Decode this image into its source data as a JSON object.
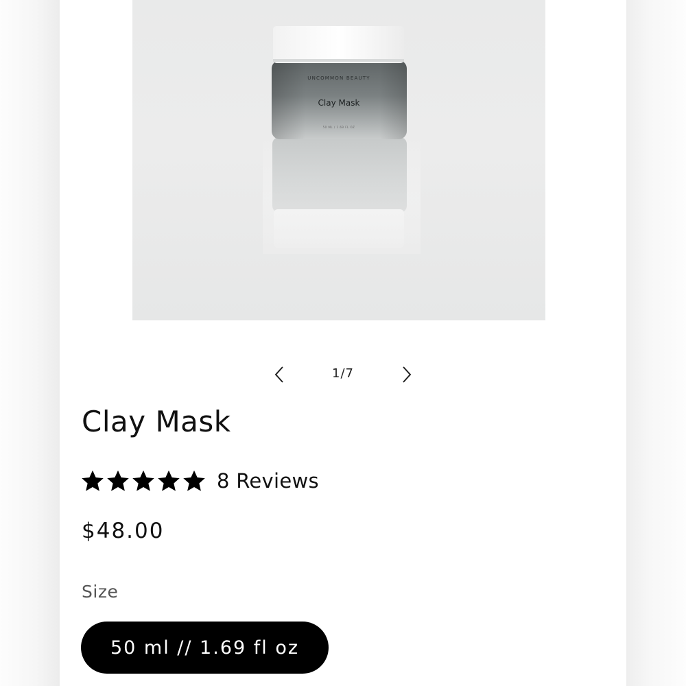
{
  "product": {
    "title": "Clay Mask",
    "brand_on_jar": "UNCOMMON BEAUTY",
    "name_on_jar": "Clay Mask",
    "size_on_jar": "50 ML / 1.69 FL OZ",
    "reviews_label": "8 Reviews",
    "rating": 5,
    "rating_max": 5,
    "price": "$48.00",
    "size_label": "Size",
    "size_option": "50 ml // 1.69 fl oz"
  },
  "carousel": {
    "counter": "1/7",
    "prev_icon": "chevron-left-icon",
    "next_icon": "chevron-right-icon"
  },
  "colors": {
    "page_bg": "#ffffff",
    "text": "#111111",
    "pill_bg": "#000000",
    "pill_text": "#ffffff",
    "label_gray": "#555555"
  }
}
